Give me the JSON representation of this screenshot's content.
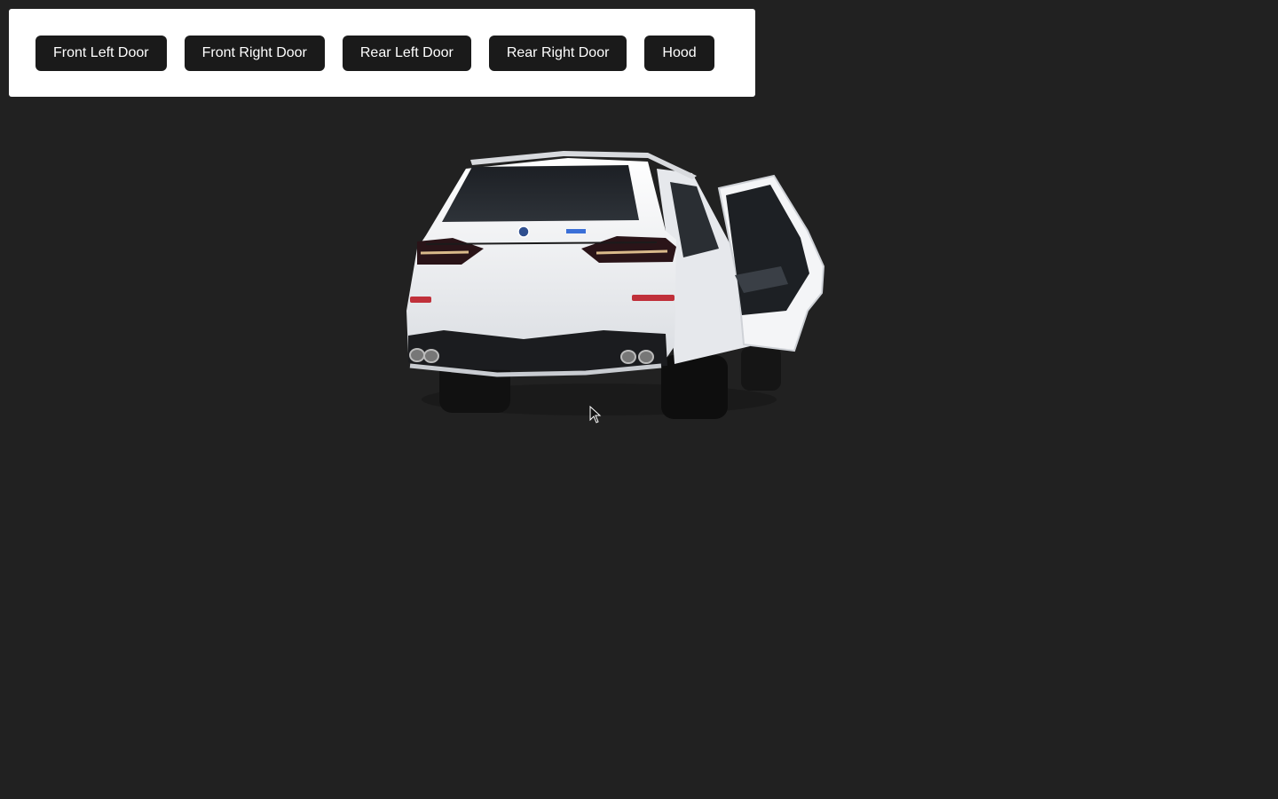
{
  "toolbar": {
    "buttons": [
      {
        "label": "Front Left Door"
      },
      {
        "label": "Front Right Door"
      },
      {
        "label": "Rear Left Door"
      },
      {
        "label": "Rear Right Door"
      },
      {
        "label": "Hood"
      }
    ]
  },
  "viewer": {
    "model": "car-rear-view",
    "open_part": "rear-right-door"
  },
  "colors": {
    "background": "#212121",
    "panel": "#ffffff",
    "button_bg": "#1a1a1a",
    "button_text": "#ffffff",
    "car_body": "#eef0f3",
    "taillight": "#c0303a"
  }
}
